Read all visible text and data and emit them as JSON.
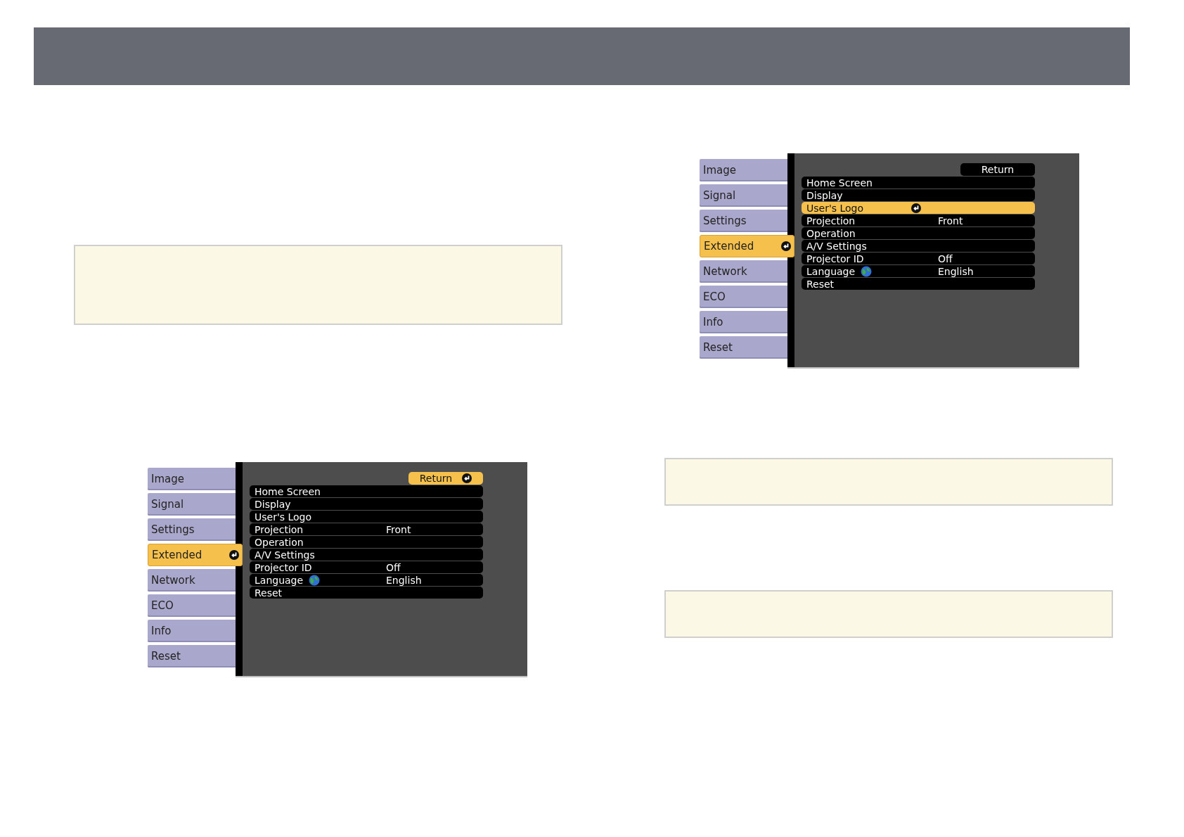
{
  "menus": [
    {
      "sidebar": [
        {
          "label": "Image",
          "selected": false
        },
        {
          "label": "Signal",
          "selected": false
        },
        {
          "label": "Settings",
          "selected": false
        },
        {
          "label": "Extended",
          "selected": true
        },
        {
          "label": "Network",
          "selected": false
        },
        {
          "label": "ECO",
          "selected": false
        },
        {
          "label": "Info",
          "selected": false
        },
        {
          "label": "Reset",
          "selected": false
        }
      ],
      "return_button": {
        "label": "Return",
        "selected": true
      },
      "rows": [
        {
          "label": "Home Screen",
          "selected": false,
          "kind": "plain"
        },
        {
          "label": "Display",
          "selected": false,
          "kind": "plain"
        },
        {
          "label": "User's Logo",
          "selected": false,
          "kind": "plain"
        },
        {
          "label": "Projection",
          "value": "Front",
          "selected": false,
          "kind": "plain"
        },
        {
          "label": "Operation",
          "selected": false,
          "kind": "plain"
        },
        {
          "label": "A/V Settings",
          "selected": false,
          "kind": "plain"
        },
        {
          "label": "Projector ID",
          "value": "Off",
          "selected": false,
          "kind": "plain"
        },
        {
          "label": "Language",
          "value": "English",
          "selected": false,
          "kind": "globe"
        },
        {
          "label": "Reset",
          "selected": false,
          "kind": "plain"
        }
      ]
    },
    {
      "sidebar": [
        {
          "label": "Image",
          "selected": false
        },
        {
          "label": "Signal",
          "selected": false
        },
        {
          "label": "Settings",
          "selected": false
        },
        {
          "label": "Extended",
          "selected": true
        },
        {
          "label": "Network",
          "selected": false
        },
        {
          "label": "ECO",
          "selected": false
        },
        {
          "label": "Info",
          "selected": false
        },
        {
          "label": "Reset",
          "selected": false
        }
      ],
      "return_button": {
        "label": "Return",
        "selected": false
      },
      "rows": [
        {
          "label": "Home Screen",
          "selected": false,
          "kind": "plain"
        },
        {
          "label": "Display",
          "selected": false,
          "kind": "plain"
        },
        {
          "label": "User's Logo",
          "selected": true,
          "kind": "plain"
        },
        {
          "label": "Projection",
          "value": "Front",
          "selected": false,
          "kind": "plain"
        },
        {
          "label": "Operation",
          "selected": false,
          "kind": "plain"
        },
        {
          "label": "A/V Settings",
          "selected": false,
          "kind": "plain"
        },
        {
          "label": "Projector ID",
          "value": "Off",
          "selected": false,
          "kind": "plain"
        },
        {
          "label": "Language",
          "value": "English",
          "selected": false,
          "kind": "globe"
        },
        {
          "label": "Reset",
          "selected": false,
          "kind": "plain"
        }
      ]
    }
  ]
}
